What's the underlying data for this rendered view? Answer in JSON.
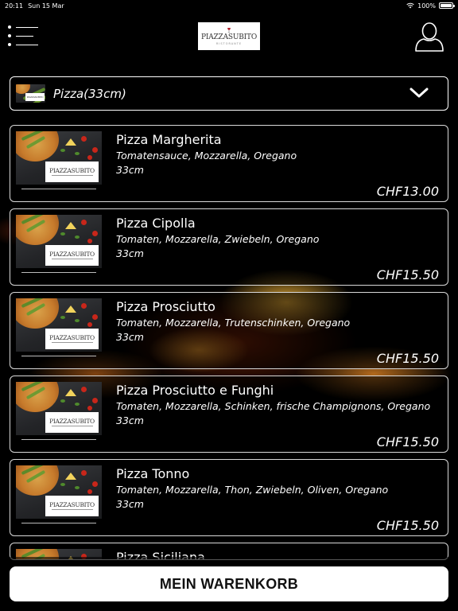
{
  "status_bar": {
    "time": "20:11",
    "date": "Sun 15 Mar",
    "battery": "100%",
    "battery_level": 1.0
  },
  "header": {
    "logo_text": "PIAZZASUBITO",
    "logo_sub": "RISTORANTE"
  },
  "category": {
    "selected": "Pizza(33cm)",
    "thumb_logo": "PIAZZASUBITO"
  },
  "products": [
    {
      "name": "Pizza Margherita",
      "description": "Tomatensauce, Mozzarella, Oregano",
      "size": "33cm",
      "price": "CHF13.00",
      "thumb_logo": "PIAZZASUBITO"
    },
    {
      "name": "Pizza Cipolla",
      "description": "Tomaten, Mozzarella, Zwiebeln, Oregano",
      "size": "33cm",
      "price": "CHF15.50",
      "thumb_logo": "PIAZZASUBITO"
    },
    {
      "name": "Pizza Prosciutto",
      "description": "Tomaten, Mozzarella, Trutenschinken, Oregano",
      "size": "33cm",
      "price": "CHF15.50",
      "thumb_logo": "PIAZZASUBITO"
    },
    {
      "name": "Pizza Prosciutto e Funghi",
      "description": "Tomaten, Mozzarella, Schinken, frische Champignons, Oregano",
      "size": "33cm",
      "price": "CHF15.50",
      "thumb_logo": "PIAZZASUBITO"
    },
    {
      "name": "Pizza Tonno",
      "description": "Tomaten, Mozzarella, Thon, Zwiebeln, Oliven, Oregano",
      "size": "33cm",
      "price": "CHF15.50",
      "thumb_logo": "PIAZZASUBITO"
    },
    {
      "name": "Pizza Siciliana"
    }
  ],
  "cart": {
    "label": "MEIN WARENKORB"
  },
  "colors": {
    "background": "#000000",
    "text": "#ffffff",
    "card_border": "#d9d9d9",
    "cart_button": "#ffffff",
    "cart_text": "#111111"
  },
  "icons": {
    "menu": "menu-icon",
    "user": "user-icon",
    "chevron": "chevron-down-icon",
    "wifi": "wifi-icon",
    "battery": "battery-icon"
  }
}
